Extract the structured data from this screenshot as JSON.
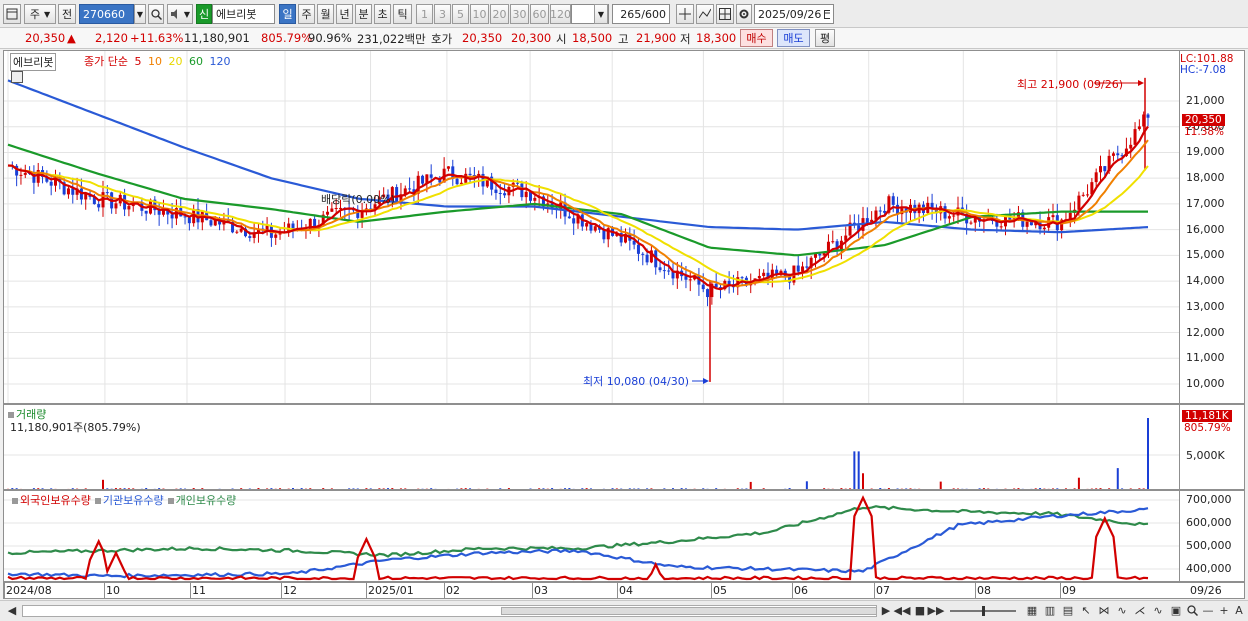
{
  "toolbar": {
    "period_sel": "주",
    "compare_sel": "전",
    "code": "270660",
    "badge": "신",
    "stock_name": "에브리봇",
    "periods": [
      "일",
      "주",
      "월",
      "년",
      "분",
      "초",
      "틱"
    ],
    "active_period": "일",
    "intervals": [
      "1",
      "3",
      "5",
      "10",
      "20",
      "30",
      "60",
      "120"
    ],
    "count": "265",
    "count_max": "/600",
    "date": "2025/09/26"
  },
  "info": {
    "price": "20,350",
    "arrow": "▲",
    "change": "2,120",
    "change_pct": "+11.63%",
    "volume": "11,180,901",
    "vol_ratio": "805.79%",
    "turnover": "90.96%",
    "amount": "231,022백만",
    "quote_label": "호가",
    "ask": "20,350",
    "bid": "20,300",
    "open_label": "시",
    "open": "18,500",
    "high_label": "고",
    "high": "21,900",
    "low_label": "저",
    "low": "18,300",
    "buy_btn": "매수",
    "sell_btn": "매도",
    "eval_btn": "평"
  },
  "price_panel": {
    "name": "에브리봇",
    "legend_label": "종가 단순",
    "ma": [
      {
        "period": "5",
        "color": "#d20000"
      },
      {
        "period": "10",
        "color": "#f08000"
      },
      {
        "period": "20",
        "color": "#e8d800"
      },
      {
        "period": "60",
        "color": "#1a9a2a"
      },
      {
        "period": "120",
        "color": "#2a5ad6"
      }
    ],
    "lc": "LC:101.88",
    "hc": "HC:-7.08",
    "y_ticks": [
      "21,000",
      "20,000",
      "19,000",
      "18,000",
      "17,000",
      "16,000",
      "15,000",
      "14,000",
      "13,000",
      "12,000",
      "11,000",
      "10,000"
    ],
    "current_tag": "20,350",
    "current_pct": "11.38%",
    "high_note": "최고 21,900 (09/26)",
    "low_note": "최저 10,080 (04/30)",
    "dividend_note": "배당락(0.00%)"
  },
  "volume_panel": {
    "title": "거래량",
    "value": "11,180,901주(805.79%)",
    "tag": "11,181K",
    "tag_pct": "805.79%",
    "y_tick": "5,000K"
  },
  "holders_panel": {
    "series": [
      {
        "name": "외국인보유수량",
        "color": "#d20000"
      },
      {
        "name": "기관보유수량",
        "color": "#2a5ad6"
      },
      {
        "name": "개인보유수량",
        "color": "#2e8a4a"
      }
    ],
    "y_ticks": [
      "700,000",
      "600,000",
      "500,000",
      "400,000"
    ]
  },
  "x_axis": {
    "labels": [
      "2024/08",
      "10",
      "11",
      "12",
      "2025/01",
      "02",
      "03",
      "04",
      "05",
      "06",
      "07",
      "08",
      "09",
      "09/26"
    ]
  },
  "chart_data": {
    "type": "line",
    "x_labels": [
      "2024/08",
      "10",
      "11",
      "12",
      "2025/01",
      "02",
      "03",
      "04",
      "05",
      "06",
      "07",
      "08",
      "09"
    ],
    "price_close": [
      18500,
      17200,
      16600,
      15800,
      16800,
      18200,
      17400,
      15600,
      13600,
      14300,
      17000,
      16500,
      16300,
      20350
    ],
    "ma120": [
      21800,
      20500,
      19200,
      18000,
      17200,
      16900,
      16900,
      16500,
      16100,
      16000,
      16300,
      16000,
      15900,
      16100
    ],
    "ma60": [
      19300,
      18200,
      17200,
      16800,
      16300,
      16700,
      17000,
      16600,
      15300,
      15000,
      15400,
      16500,
      16700,
      16700
    ],
    "high": {
      "value": 21900,
      "date": "09/26"
    },
    "low": {
      "value": 10080,
      "date": "04/30"
    },
    "ylim": [
      9500,
      22000
    ],
    "volume_last_k": 11181,
    "holders": {
      "foreign": [
        360000,
        360000,
        360000,
        360000,
        360000,
        360000,
        360000,
        360000,
        360000,
        360000,
        360000,
        360000,
        360000
      ],
      "institution": [
        380000,
        370000,
        375000,
        380000,
        440000,
        470000,
        480000,
        410000,
        400000,
        390000,
        590000,
        630000,
        660000
      ],
      "individual": [
        470000,
        480000,
        490000,
        480000,
        460000,
        490000,
        490000,
        520000,
        560000,
        670000,
        650000,
        640000,
        590000
      ]
    }
  }
}
